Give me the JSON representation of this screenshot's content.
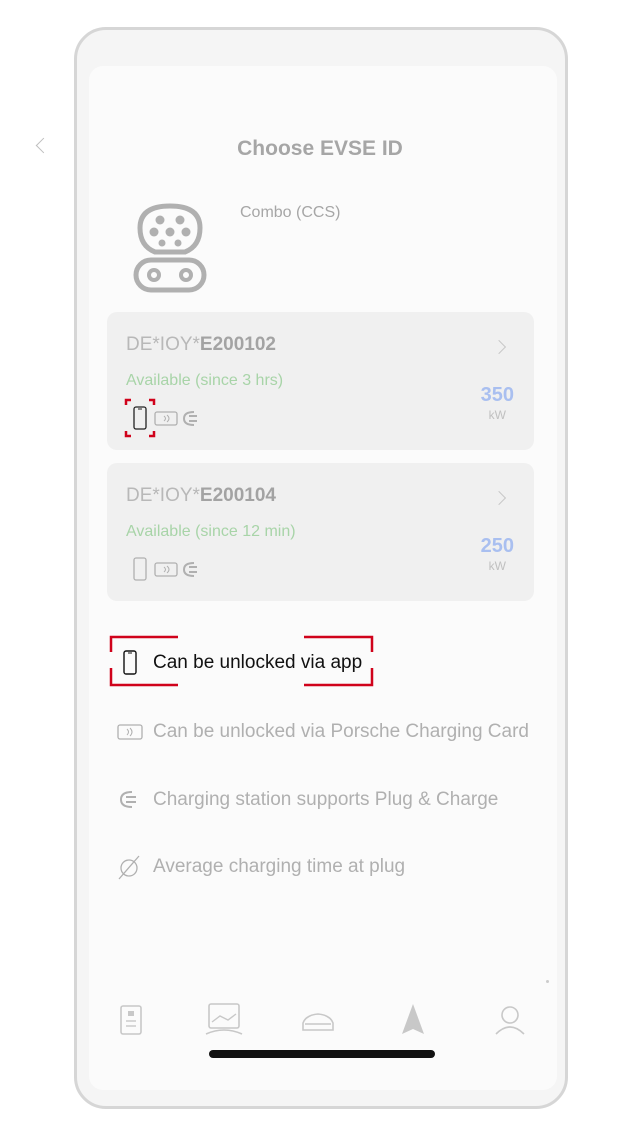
{
  "header": {
    "title": "Choose EVSE ID",
    "back_icon": "chevron-left-icon"
  },
  "connector": {
    "name": "Combo (CCS)",
    "icon": "ccs-plug-icon"
  },
  "stations": [
    {
      "id_prefix": "DE*IOY*",
      "id_bold": "E200102",
      "status": "Available (since 3 hrs)",
      "power": "350",
      "unit": "kW",
      "highlight_app": true
    },
    {
      "id_prefix": "DE*IOY*",
      "id_bold": "E200104",
      "status": "Available (since 12 min)",
      "power": "250",
      "unit": "kW",
      "highlight_app": false
    }
  ],
  "legend": [
    {
      "icon": "phone-icon",
      "text": "Can be unlocked via app",
      "active": true
    },
    {
      "icon": "charging-card-icon",
      "text": "Can be unlocked via Porsche Charging Card",
      "active": false
    },
    {
      "icon": "plug-and-charge-icon",
      "text": "Charging station supports Plug & Charge",
      "active": false
    },
    {
      "icon": "no-average-time-icon",
      "text": "Average charging time at plug",
      "active": false
    }
  ],
  "bottom_nav": [
    "card-icon",
    "charging-screen-icon",
    "car-icon",
    "navigation-arrow-icon",
    "profile-icon"
  ],
  "colors": {
    "highlight": "#d0021b",
    "available": "#a8d4a8",
    "power": "#a9bff0"
  }
}
